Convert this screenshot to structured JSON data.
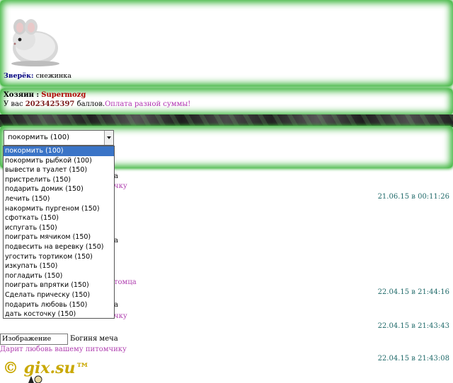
{
  "pet": {
    "label": "Зверёк:",
    "name": "снежинка"
  },
  "owner": {
    "label": "Хозяин :",
    "nick": "Supermozg"
  },
  "balance": {
    "prefix": "У вас",
    "points": "2023425397",
    "suffix": "баллов.",
    "pay_link": "Оплата разной суммы!"
  },
  "action_select": {
    "value": "покормить (100)",
    "options": [
      "покормить (100)",
      "покормить рыбкой (100)",
      "вывести в туалет (150)",
      "пристрелить (150)",
      "подарить домик (150)",
      "лечить (150)",
      "накормить пургеном (150)",
      "сфоткать (150)",
      "испугать (150)",
      "поиграть мячиком (150)",
      "подвесить на веревку (150)",
      "угостить тортиком (150)",
      "изкупать (150)",
      "погладить (150)",
      "поиграть впрятки (150)",
      "Сделать прическу (150)",
      "подарить любовь (150)",
      "дать косточку (150)"
    ]
  },
  "comments": {
    "c1_frag1": "а",
    "c1_frag2": "чку",
    "c1_date": "21.06.15 в 00:11:26",
    "c2_frag1": "а",
    "c2_frag2": "томца",
    "c2_date": "22.04.15 в 21:44:16",
    "c3_frag1": "а",
    "c3_frag2": "чку",
    "c3_date": "22.04.15 в 21:43:43",
    "c4_img_label": "Изображение",
    "c4_author": "Богиня меча",
    "c4_text": "Дарит любовь вашему питомчику",
    "c4_date": "22.04.15 в 21:43:08"
  },
  "footer": {
    "logo": "© gix.su",
    "tm": "™"
  },
  "colors": {
    "panel_glow": "#37b237",
    "selected_option": "#3a74c7",
    "date_text": "#206a6a",
    "pink_text": "#b040b0",
    "logo": "#c9a800"
  }
}
